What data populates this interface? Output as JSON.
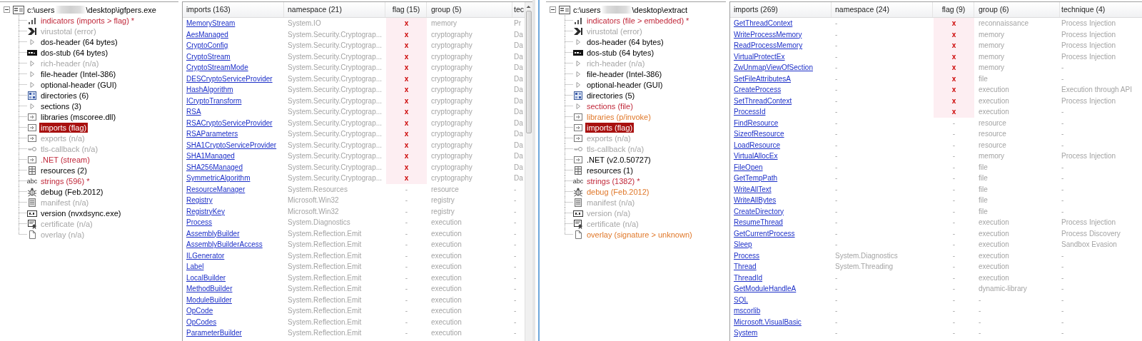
{
  "panes": [
    {
      "tree": {
        "root": {
          "expanded": true,
          "path_start": "c:\\users",
          "path_end": "\\desktop\\igfpers.exe"
        },
        "items": [
          {
            "label": "indicators (imports > flag) *",
            "kind": "chart",
            "color": "#c0283a",
            "selected": false
          },
          {
            "label": "virustotal (error)",
            "kind": "vt",
            "color": "#a6a6a6",
            "selected": false
          },
          {
            "label": "dos-header (64 bytes)",
            "kind": "triangle",
            "selected": false
          },
          {
            "label": "dos-stub (64 bytes)",
            "kind": "dos",
            "selected": false
          },
          {
            "label": "rich-header (n/a)",
            "kind": "triangle",
            "color": "#a6a6a6",
            "selected": false
          },
          {
            "label": "file-header (Intel-386)",
            "kind": "triangle",
            "selected": false
          },
          {
            "label": "optional-header (GUI)",
            "kind": "triangle",
            "selected": false
          },
          {
            "label": "directories (6)",
            "kind": "grid",
            "selected": false
          },
          {
            "label": "sections (3)",
            "kind": "triangle",
            "selected": false
          },
          {
            "label": "libraries (mscoree.dll)",
            "kind": "module",
            "selected": false
          },
          {
            "label": "imports (flag)",
            "kind": "module",
            "selected": true
          },
          {
            "label": "exports (n/a)",
            "kind": "module",
            "color": "#a6a6a6",
            "selected": false
          },
          {
            "label": "tls-callback (n/a)",
            "kind": "key",
            "color": "#a6a6a6",
            "selected": false
          },
          {
            "label": ".NET (stream)",
            "kind": "module",
            "color": "#c0283a",
            "selected": false
          },
          {
            "label": "resources (2)",
            "kind": "resources",
            "selected": false
          },
          {
            "label": "strings (596) *",
            "kind": "abc",
            "icon_text": "abc",
            "color": "#c0283a",
            "selected": false
          },
          {
            "label": "debug (Feb.2012)",
            "kind": "bug",
            "selected": false
          },
          {
            "label": "manifest (n/a)",
            "kind": "manifest",
            "color": "#a6a6a6",
            "selected": false
          },
          {
            "label": "version (nvxdsync.exe)",
            "kind": "version",
            "selected": false
          },
          {
            "label": "certificate (n/a)",
            "kind": "cert",
            "color": "#a6a6a6",
            "selected": false
          },
          {
            "label": "overlay (n/a)",
            "kind": "page",
            "color": "#a6a6a6",
            "selected": false
          }
        ]
      },
      "table": {
        "scrollbar": true,
        "columns": [
          {
            "label": "imports (163)",
            "kind": "link"
          },
          {
            "label": "namespace (21)",
            "kind": "text"
          },
          {
            "label": "flag (15)",
            "kind": "flag"
          },
          {
            "label": "group (5)",
            "kind": "text"
          },
          {
            "label": "tec",
            "kind": "text"
          }
        ],
        "rows": [
          {
            "flagged": true,
            "cells": [
              "MemoryStream",
              "System.IO",
              "x",
              "memory",
              "Pr"
            ]
          },
          {
            "flagged": true,
            "cells": [
              "AesManaged",
              "System.Security.Cryptograp...",
              "x",
              "cryptography",
              "Da"
            ]
          },
          {
            "flagged": true,
            "cells": [
              "CryptoConfig",
              "System.Security.Cryptograp...",
              "x",
              "cryptography",
              "Da"
            ]
          },
          {
            "flagged": true,
            "cells": [
              "CryptoStream",
              "System.Security.Cryptograp...",
              "x",
              "cryptography",
              "Da"
            ]
          },
          {
            "flagged": true,
            "cells": [
              "CryptoStreamMode",
              "System.Security.Cryptograp...",
              "x",
              "cryptography",
              "Da"
            ]
          },
          {
            "flagged": true,
            "cells": [
              "DESCryptoServiceProvider",
              "System.Security.Cryptograp...",
              "x",
              "cryptography",
              "Da"
            ]
          },
          {
            "flagged": true,
            "cells": [
              "HashAlgorithm",
              "System.Security.Cryptograp...",
              "x",
              "cryptography",
              "Da"
            ]
          },
          {
            "flagged": true,
            "cells": [
              "ICryptoTransform",
              "System.Security.Cryptograp...",
              "x",
              "cryptography",
              "Da"
            ]
          },
          {
            "flagged": true,
            "cells": [
              "RSA",
              "System.Security.Cryptograp...",
              "x",
              "cryptography",
              "Da"
            ]
          },
          {
            "flagged": true,
            "cells": [
              "RSACryptoServiceProvider",
              "System.Security.Cryptograp...",
              "x",
              "cryptography",
              "Da"
            ]
          },
          {
            "flagged": true,
            "cells": [
              "RSAParameters",
              "System.Security.Cryptograp...",
              "x",
              "cryptography",
              "Da"
            ]
          },
          {
            "flagged": true,
            "cells": [
              "SHA1CryptoServiceProvider",
              "System.Security.Cryptograp...",
              "x",
              "cryptography",
              "Da"
            ]
          },
          {
            "flagged": true,
            "cells": [
              "SHA1Managed",
              "System.Security.Cryptograp...",
              "x",
              "cryptography",
              "Da"
            ]
          },
          {
            "flagged": true,
            "cells": [
              "SHA256Managed",
              "System.Security.Cryptograp...",
              "x",
              "cryptography",
              "Da"
            ]
          },
          {
            "flagged": true,
            "cells": [
              "SymmetricAlgorithm",
              "System.Security.Cryptograp...",
              "x",
              "cryptography",
              "Da"
            ]
          },
          {
            "flagged": false,
            "cells": [
              "ResourceManager",
              "System.Resources",
              "-",
              "resource",
              "-"
            ]
          },
          {
            "flagged": false,
            "cells": [
              "Registry",
              "Microsoft.Win32",
              "-",
              "registry",
              "-"
            ]
          },
          {
            "flagged": false,
            "cells": [
              "RegistryKey",
              "Microsoft.Win32",
              "-",
              "registry",
              "-"
            ]
          },
          {
            "flagged": false,
            "cells": [
              "Process",
              "System.Diagnostics",
              "-",
              "execution",
              "-"
            ]
          },
          {
            "flagged": false,
            "cells": [
              "AssemblyBuilder",
              "System.Reflection.Emit",
              "-",
              "execution",
              "-"
            ]
          },
          {
            "flagged": false,
            "cells": [
              "AssemblyBuilderAccess",
              "System.Reflection.Emit",
              "-",
              "execution",
              "-"
            ]
          },
          {
            "flagged": false,
            "cells": [
              "ILGenerator",
              "System.Reflection.Emit",
              "-",
              "execution",
              "-"
            ]
          },
          {
            "flagged": false,
            "cells": [
              "Label",
              "System.Reflection.Emit",
              "-",
              "execution",
              "-"
            ]
          },
          {
            "flagged": false,
            "cells": [
              "LocalBuilder",
              "System.Reflection.Emit",
              "-",
              "execution",
              "-"
            ]
          },
          {
            "flagged": false,
            "cells": [
              "MethodBuilder",
              "System.Reflection.Emit",
              "-",
              "execution",
              "-"
            ]
          },
          {
            "flagged": false,
            "cells": [
              "ModuleBuilder",
              "System.Reflection.Emit",
              "-",
              "execution",
              "-"
            ]
          },
          {
            "flagged": false,
            "cells": [
              "OpCode",
              "System.Reflection.Emit",
              "-",
              "execution",
              "-"
            ]
          },
          {
            "flagged": false,
            "cells": [
              "OpCodes",
              "System.Reflection.Emit",
              "-",
              "execution",
              "-"
            ]
          },
          {
            "flagged": false,
            "cells": [
              "ParameterBuilder",
              "System.Reflection.Emit",
              "-",
              "execution",
              "-"
            ]
          }
        ]
      }
    },
    {
      "tree": {
        "root": {
          "expanded": true,
          "path_start": "c:\\users",
          "path_end": "\\desktop\\extract"
        },
        "items": [
          {
            "label": "indicators (file > embedded) *",
            "kind": "chart",
            "color": "#c0283a",
            "selected": false
          },
          {
            "label": "virustotal (error)",
            "kind": "vt",
            "color": "#a6a6a6",
            "selected": false
          },
          {
            "label": "dos-header (64 bytes)",
            "kind": "triangle",
            "selected": false
          },
          {
            "label": "dos-stub (64 bytes)",
            "kind": "dos",
            "selected": false
          },
          {
            "label": "rich-header (n/a)",
            "kind": "triangle",
            "color": "#a6a6a6",
            "selected": false
          },
          {
            "label": "file-header (Intel-386)",
            "kind": "triangle",
            "selected": false
          },
          {
            "label": "optional-header (GUI)",
            "kind": "triangle",
            "selected": false
          },
          {
            "label": "directories (5)",
            "kind": "grid",
            "selected": false
          },
          {
            "label": "sections (file)",
            "kind": "triangle",
            "color": "#c0283a",
            "selected": false
          },
          {
            "label": "libraries (p/invoke)",
            "kind": "module",
            "color": "#e0782a",
            "selected": false
          },
          {
            "label": "imports (flag)",
            "kind": "module",
            "selected": true
          },
          {
            "label": "exports (n/a)",
            "kind": "module",
            "color": "#a6a6a6",
            "selected": false
          },
          {
            "label": "tls-callback (n/a)",
            "kind": "key",
            "color": "#a6a6a6",
            "selected": false
          },
          {
            "label": ".NET (v2.0.50727)",
            "kind": "module",
            "selected": false
          },
          {
            "label": "resources (1)",
            "kind": "resources",
            "selected": false
          },
          {
            "label": "strings (1382) *",
            "kind": "abc",
            "icon_text": "abc",
            "color": "#c0283a",
            "selected": false
          },
          {
            "label": "debug (Feb.2012)",
            "kind": "bug",
            "color": "#e0782a",
            "selected": false
          },
          {
            "label": "manifest (n/a)",
            "kind": "manifest",
            "color": "#a6a6a6",
            "selected": false
          },
          {
            "label": "version (n/a)",
            "kind": "version",
            "color": "#a6a6a6",
            "selected": false
          },
          {
            "label": "certificate (n/a)",
            "kind": "cert",
            "color": "#a6a6a6",
            "selected": false
          },
          {
            "label": "overlay (signature > unknown)",
            "kind": "page",
            "color": "#e0782a",
            "selected": false
          }
        ]
      },
      "table": {
        "scrollbar": false,
        "columns": [
          {
            "label": "imports (269)",
            "kind": "link"
          },
          {
            "label": "namespace (24)",
            "kind": "text"
          },
          {
            "label": "flag (9)",
            "kind": "flag"
          },
          {
            "label": "group (6)",
            "kind": "text"
          },
          {
            "label": "technique (4)",
            "kind": "text"
          }
        ],
        "rows": [
          {
            "flagged": true,
            "cells": [
              "GetThreadContext",
              "-",
              "x",
              "reconnaissance",
              "Process Injection"
            ]
          },
          {
            "flagged": true,
            "cells": [
              "WriteProcessMemory",
              "-",
              "x",
              "memory",
              "Process Injection"
            ]
          },
          {
            "flagged": true,
            "cells": [
              "ReadProcessMemory",
              "-",
              "x",
              "memory",
              "Process Injection"
            ]
          },
          {
            "flagged": true,
            "cells": [
              "VirtualProtectEx",
              "-",
              "x",
              "memory",
              "Process Injection"
            ]
          },
          {
            "flagged": true,
            "cells": [
              "ZwUnmapViewOfSection",
              "-",
              "x",
              "memory",
              "-"
            ]
          },
          {
            "flagged": true,
            "cells": [
              "SetFileAttributesA",
              "-",
              "x",
              "file",
              "-"
            ]
          },
          {
            "flagged": true,
            "cells": [
              "CreateProcess",
              "-",
              "x",
              "execution",
              "Execution through API"
            ]
          },
          {
            "flagged": true,
            "cells": [
              "SetThreadContext",
              "-",
              "x",
              "execution",
              "Process Injection"
            ]
          },
          {
            "flagged": true,
            "cells": [
              "ProcessId",
              "-",
              "x",
              "execution",
              "-"
            ]
          },
          {
            "flagged": false,
            "cells": [
              "FindResource",
              "-",
              "-",
              "resource",
              "-"
            ]
          },
          {
            "flagged": false,
            "cells": [
              "SizeofResource",
              "-",
              "-",
              "resource",
              "-"
            ]
          },
          {
            "flagged": false,
            "cells": [
              "LoadResource",
              "-",
              "-",
              "resource",
              "-"
            ]
          },
          {
            "flagged": false,
            "cells": [
              "VirtualAllocEx",
              "-",
              "-",
              "memory",
              "Process Injection"
            ]
          },
          {
            "flagged": false,
            "cells": [
              "FileOpen",
              "-",
              "-",
              "file",
              "-"
            ]
          },
          {
            "flagged": false,
            "cells": [
              "GetTempPath",
              "-",
              "-",
              "file",
              "-"
            ]
          },
          {
            "flagged": false,
            "cells": [
              "WriteAllText",
              "-",
              "-",
              "file",
              "-"
            ]
          },
          {
            "flagged": false,
            "cells": [
              "WriteAllBytes",
              "-",
              "-",
              "file",
              "-"
            ]
          },
          {
            "flagged": false,
            "cells": [
              "CreateDirectory",
              "-",
              "-",
              "file",
              "-"
            ]
          },
          {
            "flagged": false,
            "cells": [
              "ResumeThread",
              "-",
              "-",
              "execution",
              "Process Injection"
            ]
          },
          {
            "flagged": false,
            "cells": [
              "GetCurrentProcess",
              "-",
              "-",
              "execution",
              "Process Discovery"
            ]
          },
          {
            "flagged": false,
            "cells": [
              "Sleep",
              "-",
              "-",
              "execution",
              "Sandbox Evasion"
            ]
          },
          {
            "flagged": false,
            "cells": [
              "Process",
              "System.Diagnostics",
              "-",
              "execution",
              "-"
            ]
          },
          {
            "flagged": false,
            "cells": [
              "Thread",
              "System.Threading",
              "-",
              "execution",
              "-"
            ]
          },
          {
            "flagged": false,
            "cells": [
              "ThreadId",
              "-",
              "-",
              "execution",
              "-"
            ]
          },
          {
            "flagged": false,
            "cells": [
              "GetModuleHandleA",
              "-",
              "-",
              "dynamic-library",
              "-"
            ]
          },
          {
            "flagged": false,
            "cells": [
              "SQL",
              "-",
              "-",
              "-",
              "-"
            ]
          },
          {
            "flagged": false,
            "cells": [
              "mscorlib",
              "-",
              "-",
              "-",
              "-"
            ]
          },
          {
            "flagged": false,
            "cells": [
              "Microsoft.VisualBasic",
              "-",
              "-",
              "-",
              "-"
            ]
          },
          {
            "flagged": false,
            "cells": [
              "System",
              "-",
              "-",
              "-",
              "-"
            ]
          }
        ]
      }
    }
  ]
}
